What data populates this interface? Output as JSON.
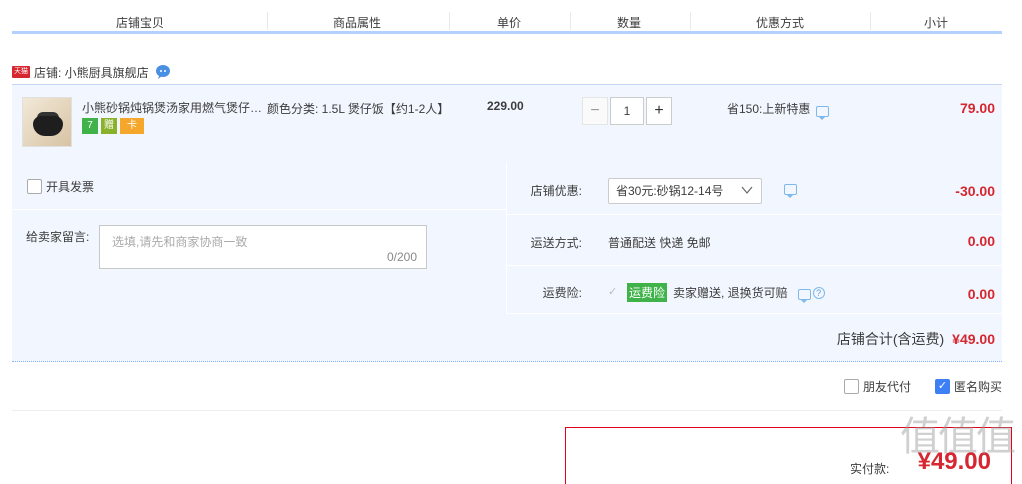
{
  "header": {
    "columns": [
      "店铺宝贝",
      "商品属性",
      "单价",
      "数量",
      "优惠方式",
      "小计"
    ]
  },
  "shop": {
    "badge": "天猫",
    "label": "店铺: 小熊厨具旗舰店"
  },
  "item": {
    "title": "小熊砂锅炖锅煲汤家用燃气煲仔饭砂锅",
    "service_icons": [
      "7",
      "赠",
      "卡"
    ],
    "attributes": "颜色分类: 1.5L 煲仔饭【约1-2人】",
    "price": "229.00",
    "quantity": "1",
    "qty_minus": "−",
    "qty_plus": "+",
    "promo": "省150:上新特惠",
    "subtotal": "79.00"
  },
  "options": {
    "invoice_label": "开具发票",
    "message_label": "给卖家留言:",
    "message_placeholder": "选填,请先和商家协商一致",
    "message_count": "0/200",
    "shop_discount_label": "店铺优惠:",
    "shop_discount_value": "省30元:砂锅12-14号",
    "shop_discount_amount": "-30.00",
    "shipping_label": "运送方式:",
    "shipping_value": "普通配送 快递 免邮",
    "shipping_amount": "0.00",
    "insurance_label": "运费险:",
    "insurance_tag": "运费险",
    "insurance_text": "卖家赠送, 退换货可赔",
    "insurance_amount": "0.00",
    "total_label": "店铺合计(含运费)",
    "total_amount": "¥49.00"
  },
  "footer": {
    "friend_pay": "朋友代付",
    "anonymous": "匿名购买",
    "anonymous_checked": true,
    "pay_label": "实付款:",
    "pay_amount": "¥49.00",
    "watermark": "值值值"
  }
}
